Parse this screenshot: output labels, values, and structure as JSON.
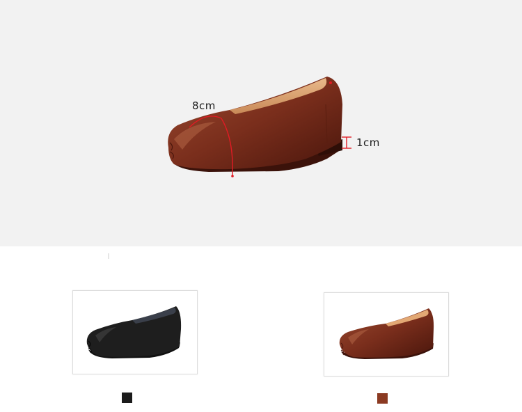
{
  "hero": {
    "dimension_width_label": "8cm",
    "dimension_heel_label": "1cm",
    "annotation_color": "#e01b24",
    "shoe_color": "#7a2e1c"
  },
  "color_options": [
    {
      "name": "black",
      "swatch_color": "#1b1b1b"
    },
    {
      "name": "brown",
      "swatch_color": "#8b3a22"
    }
  ]
}
